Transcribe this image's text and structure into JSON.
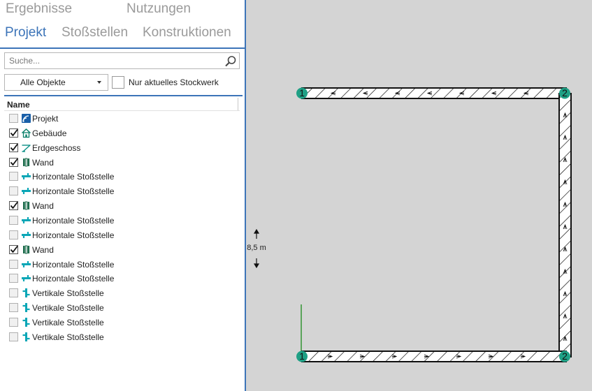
{
  "tabs": {
    "row1": [
      {
        "label": "Ergebnisse",
        "active": false
      },
      {
        "label": "Nutzungen",
        "active": false
      }
    ],
    "row2": [
      {
        "label": "Projekt",
        "active": true
      },
      {
        "label": "Stoßstellen",
        "active": false
      },
      {
        "label": "Konstruktionen",
        "active": false
      }
    ]
  },
  "search": {
    "placeholder": "Suche...",
    "value": "",
    "icon": "search-icon"
  },
  "filter": {
    "selected": "Alle Objekte",
    "only_current_floor_label": "Nur aktuelles Stockwerk",
    "only_current_floor_checked": false
  },
  "list": {
    "header": "Name",
    "items": [
      {
        "label": "Projekt",
        "checked": false,
        "icon": "project-icon"
      },
      {
        "label": "Gebäude",
        "checked": true,
        "icon": "building-icon"
      },
      {
        "label": "Erdgeschoss",
        "checked": true,
        "icon": "floor-icon"
      },
      {
        "label": "Wand",
        "checked": true,
        "icon": "wall-icon"
      },
      {
        "label": "Horizontale Stoßstelle",
        "checked": false,
        "icon": "horizontal-junction-icon"
      },
      {
        "label": "Horizontale Stoßstelle",
        "checked": false,
        "icon": "horizontal-junction-icon"
      },
      {
        "label": "Wand",
        "checked": true,
        "icon": "wall-icon"
      },
      {
        "label": "Horizontale Stoßstelle",
        "checked": false,
        "icon": "horizontal-junction-icon"
      },
      {
        "label": "Horizontale Stoßstelle",
        "checked": false,
        "icon": "horizontal-junction-icon"
      },
      {
        "label": "Wand",
        "checked": true,
        "icon": "wall-icon"
      },
      {
        "label": "Horizontale Stoßstelle",
        "checked": false,
        "icon": "horizontal-junction-icon"
      },
      {
        "label": "Horizontale Stoßstelle",
        "checked": false,
        "icon": "horizontal-junction-icon"
      },
      {
        "label": "Vertikale Stoßstelle",
        "checked": false,
        "icon": "vertical-junction-icon"
      },
      {
        "label": "Vertikale Stoßstelle",
        "checked": false,
        "icon": "vertical-junction-icon"
      },
      {
        "label": "Vertikale Stoßstelle",
        "checked": false,
        "icon": "vertical-junction-icon"
      },
      {
        "label": "Vertikale Stoßstelle",
        "checked": false,
        "icon": "vertical-junction-icon"
      }
    ]
  },
  "canvas": {
    "dimension_label": "8,5 m",
    "node_labels": {
      "top_left": "1",
      "top_right": "2",
      "bottom_left": "1",
      "bottom_right": "2"
    },
    "colors": {
      "background": "#d4d4d4",
      "node": "#1fa085",
      "axis": "#1a8a1a",
      "accent": "#3c74b8"
    }
  }
}
